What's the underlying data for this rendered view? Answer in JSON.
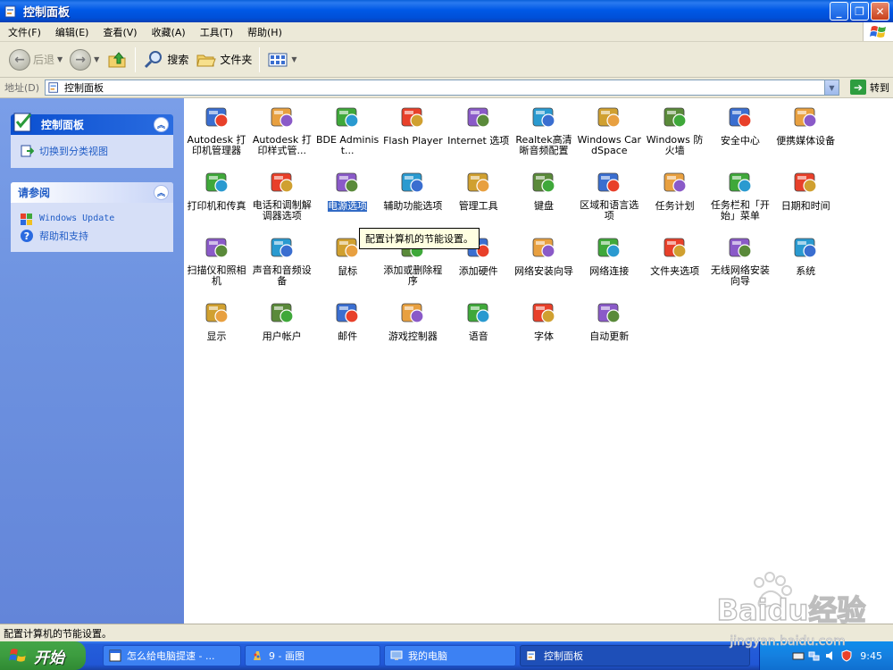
{
  "window": {
    "title": "控制面板",
    "minimize_glyph": "_",
    "maximize_glyph": "❐",
    "close_glyph": "✕"
  },
  "menubar": {
    "items": [
      "文件(F)",
      "编辑(E)",
      "查看(V)",
      "收藏(A)",
      "工具(T)",
      "帮助(H)"
    ]
  },
  "toolbar": {
    "back_label": "后退",
    "search_label": "搜索",
    "folders_label": "文件夹"
  },
  "address": {
    "label": "地址(D)",
    "value": "控制面板",
    "go_label": "转到"
  },
  "leftpane": {
    "panel1": {
      "title": "控制面板",
      "link": "切换到分类视图"
    },
    "panel2": {
      "title": "请参阅",
      "links": [
        "Windows Update",
        "帮助和支持"
      ]
    }
  },
  "icons": [
    {
      "name": "Autodesk 打印机管理器",
      "icon": "printer-manager-icon"
    },
    {
      "name": "Autodesk 打印样式管...",
      "icon": "plot-style-icon"
    },
    {
      "name": "BDE Administ...",
      "icon": "bde-admin-icon"
    },
    {
      "name": "Flash Player",
      "icon": "flash-icon"
    },
    {
      "name": "Internet 选项",
      "icon": "internet-options-icon"
    },
    {
      "name": "Realtek高清晰音频配置",
      "icon": "realtek-audio-icon"
    },
    {
      "name": "Windows CardSpace",
      "icon": "cardspace-icon"
    },
    {
      "name": "Windows 防火墙",
      "icon": "firewall-icon"
    },
    {
      "name": "安全中心",
      "icon": "security-center-icon"
    },
    {
      "name": "便携媒体设备",
      "icon": "portable-media-icon"
    },
    {
      "name": "打印机和传真",
      "icon": "printers-fax-icon"
    },
    {
      "name": "电话和调制解调器选项",
      "icon": "phone-modem-icon"
    },
    {
      "name": "电源选项",
      "icon": "power-options-icon"
    },
    {
      "name": "辅助功能选项",
      "icon": "accessibility-icon"
    },
    {
      "name": "管理工具",
      "icon": "admin-tools-icon"
    },
    {
      "name": "键盘",
      "icon": "keyboard-icon"
    },
    {
      "name": "区域和语言选项",
      "icon": "region-language-icon"
    },
    {
      "name": "任务计划",
      "icon": "scheduled-tasks-icon"
    },
    {
      "name": "任务栏和「开始」菜单",
      "icon": "taskbar-start-icon"
    },
    {
      "name": "日期和时间",
      "icon": "date-time-icon"
    },
    {
      "name": "扫描仪和照相机",
      "icon": "scanner-camera-icon"
    },
    {
      "name": "声音和音频设备",
      "icon": "sound-icon"
    },
    {
      "name": "鼠标",
      "icon": "mouse-icon"
    },
    {
      "name": "添加或删除程序",
      "icon": "add-remove-programs-icon"
    },
    {
      "name": "添加硬件",
      "icon": "add-hardware-icon"
    },
    {
      "name": "网络安装向导",
      "icon": "network-setup-icon"
    },
    {
      "name": "网络连接",
      "icon": "network-connections-icon"
    },
    {
      "name": "文件夹选项",
      "icon": "folder-options-icon"
    },
    {
      "name": "无线网络安装向导",
      "icon": "wireless-setup-icon"
    },
    {
      "name": "系统",
      "icon": "system-icon"
    },
    {
      "name": "显示",
      "icon": "display-icon"
    },
    {
      "name": "用户帐户",
      "icon": "user-accounts-icon"
    },
    {
      "name": "邮件",
      "icon": "mail-icon"
    },
    {
      "name": "游戏控制器",
      "icon": "game-controllers-icon"
    },
    {
      "name": "语音",
      "icon": "speech-icon"
    },
    {
      "name": "字体",
      "icon": "fonts-icon"
    },
    {
      "name": "自动更新",
      "icon": "automatic-updates-icon"
    }
  ],
  "selected_icon": "电源选项",
  "tooltip": "配置计算机的节能设置。",
  "statusbar": {
    "text": "配置计算机的节能设置。"
  },
  "taskbar": {
    "start_label": "开始",
    "tasks": [
      "怎么给电脑提速 - ...",
      "9 - 画图",
      "我的电脑",
      "控制面板"
    ],
    "active_task": "控制面板",
    "clock": "9:45"
  },
  "watermark": {
    "brand": "Baidu经验",
    "url": "jingyan.baidu.com"
  },
  "colors": {
    "titlebar": "#0058e6",
    "leftpane": "#6e93e0",
    "selection": "#316ac5",
    "start_button": "#3c9c3f"
  }
}
